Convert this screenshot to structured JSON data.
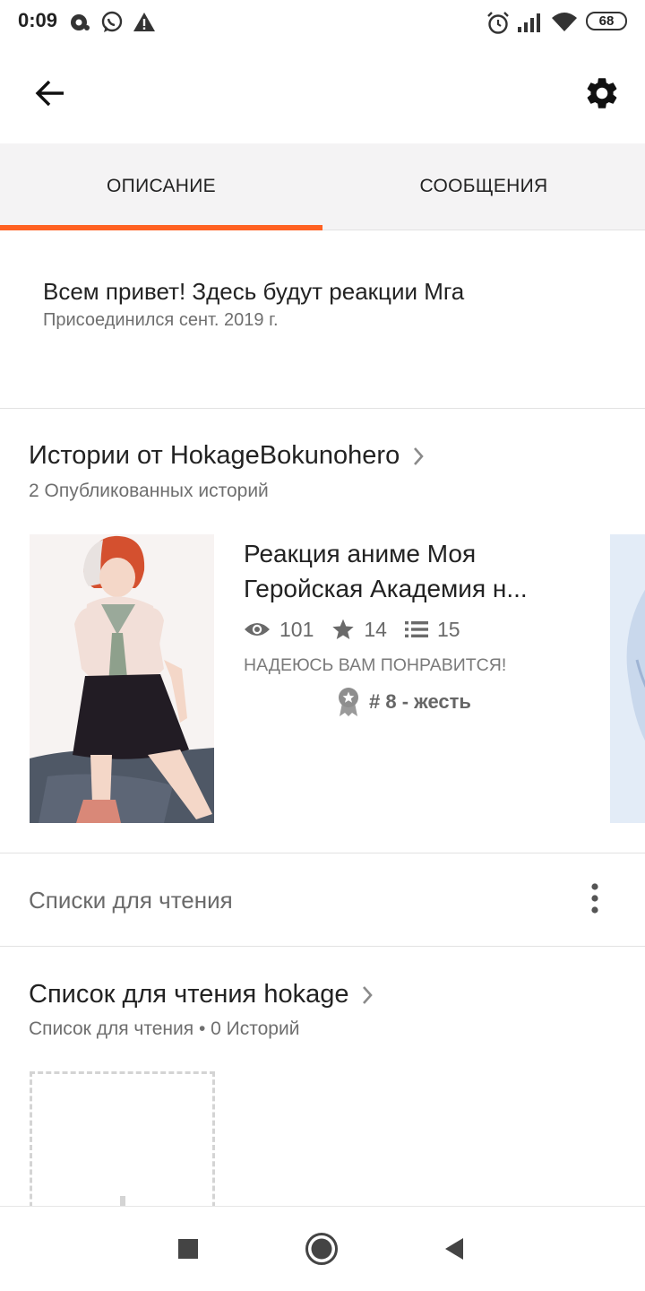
{
  "status_bar": {
    "time": "0:09",
    "battery": "68",
    "left_icons": [
      "gear-notification-icon",
      "whatsapp-icon",
      "warning-icon"
    ],
    "right_icons": [
      "alarm-icon",
      "signal-icon",
      "wifi-icon",
      "battery-icon"
    ]
  },
  "toolbar": {
    "back_icon": "arrow-left-icon",
    "settings_icon": "gear-icon"
  },
  "tabs": [
    {
      "label": "ОПИСАНИЕ",
      "active": true
    },
    {
      "label": "СООБЩЕНИЯ",
      "active": false
    }
  ],
  "profile": {
    "description": "Всем привет! Здесь будут реакции Мга",
    "joined": "Присоединился сент. 2019 г."
  },
  "stories": {
    "title": "Истории от HokageBokunohero",
    "subtitle": "2 Опубликованных историй",
    "items": [
      {
        "title_line1": "Реакция аниме  Моя",
        "title_line2": "Геройская Академия н...",
        "reads": "101",
        "votes": "14",
        "parts": "15",
        "description": "НАДЕЮСЬ ВАМ ПОНРАВИТСЯ!",
        "rank": "# 8 - жесть"
      }
    ]
  },
  "reading_lists_header": {
    "title": "Списки для чтения",
    "menu_icon": "more-vertical-icon"
  },
  "reading_list": {
    "title": "Список для чтения hokage",
    "subtitle": "Список для чтения • 0 Историй"
  },
  "nav_bar": {
    "icons": [
      "recents-square-icon",
      "home-circle-icon",
      "back-triangle-icon"
    ]
  },
  "colors": {
    "accent": "#ff6122",
    "tab_bg": "#f4f3f4",
    "secondary_text": "#6f6f6f"
  }
}
